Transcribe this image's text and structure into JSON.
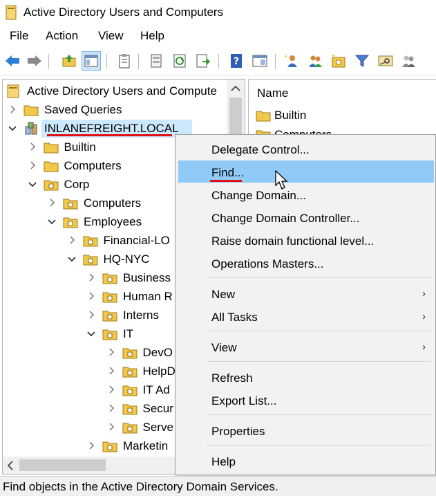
{
  "window": {
    "title": "Active Directory Users and Computers",
    "icon": "console-icon"
  },
  "menubar": {
    "items": [
      "File",
      "Action",
      "View",
      "Help"
    ]
  },
  "toolbar": {
    "buttons": [
      "back-arrow-icon",
      "forward-arrow-icon",
      "up-folder-icon",
      "show-console-tree-icon",
      "clipboard-icon",
      "properties-icon",
      "refresh-icon",
      "export-list-icon",
      "help-icon",
      "console-tree-icon",
      "new-user-icon",
      "new-group-icon",
      "new-ou-icon",
      "filter-icon",
      "find-icon",
      "add-to-group-icon"
    ]
  },
  "tree": {
    "root": "Active Directory Users and Compute",
    "items": [
      {
        "label": "Saved Queries",
        "depth": 1,
        "expanded": false
      },
      {
        "label": "INLANEFREIGHT.LOCAL",
        "depth": 1,
        "expanded": true,
        "selected": true
      },
      {
        "label": "Builtin",
        "depth": 2,
        "expanded": false
      },
      {
        "label": "Computers",
        "depth": 2,
        "expanded": false
      },
      {
        "label": "Corp",
        "depth": 2,
        "expanded": true
      },
      {
        "label": "Computers",
        "depth": 3,
        "expanded": false
      },
      {
        "label": "Employees",
        "depth": 3,
        "expanded": true
      },
      {
        "label": "Financial-LO",
        "depth": 4,
        "expanded": false
      },
      {
        "label": "HQ-NYC",
        "depth": 4,
        "expanded": true
      },
      {
        "label": "Business",
        "depth": 5,
        "expanded": false
      },
      {
        "label": "Human R",
        "depth": 5,
        "expanded": false
      },
      {
        "label": "Interns",
        "depth": 5,
        "expanded": false
      },
      {
        "label": "IT",
        "depth": 5,
        "expanded": true
      },
      {
        "label": "DevO",
        "depth": 6,
        "expanded": false
      },
      {
        "label": "HelpD",
        "depth": 6,
        "expanded": false
      },
      {
        "label": "IT Ad",
        "depth": 6,
        "expanded": false
      },
      {
        "label": "Secur",
        "depth": 6,
        "expanded": false
      },
      {
        "label": "Serve",
        "depth": 6,
        "expanded": false
      },
      {
        "label": "Marketin",
        "depth": 5,
        "expanded": false
      }
    ]
  },
  "details": {
    "column_header": "Name",
    "items": [
      "Builtin",
      "Computers"
    ]
  },
  "context_menu": {
    "highlighted": "Find...",
    "groups": [
      [
        "Delegate Control...",
        "Find...",
        "Change Domain...",
        "Change Domain Controller...",
        "Raise domain functional level...",
        "Operations Masters..."
      ],
      [
        "New",
        "All Tasks"
      ],
      [
        "View"
      ],
      [
        "Refresh",
        "Export List..."
      ],
      [
        "Properties"
      ],
      [
        "Help"
      ]
    ],
    "submenu_items": [
      "New",
      "All Tasks",
      "View"
    ],
    "submenu_arrow": "›"
  },
  "statusbar": {
    "text": "Find objects in the Active Directory Domain Services."
  },
  "colors": {
    "selection": "#cce8ff",
    "menu_highlight": "#91c9f7",
    "annotation_underline": "#e01010",
    "folder": "#f2c84b"
  }
}
